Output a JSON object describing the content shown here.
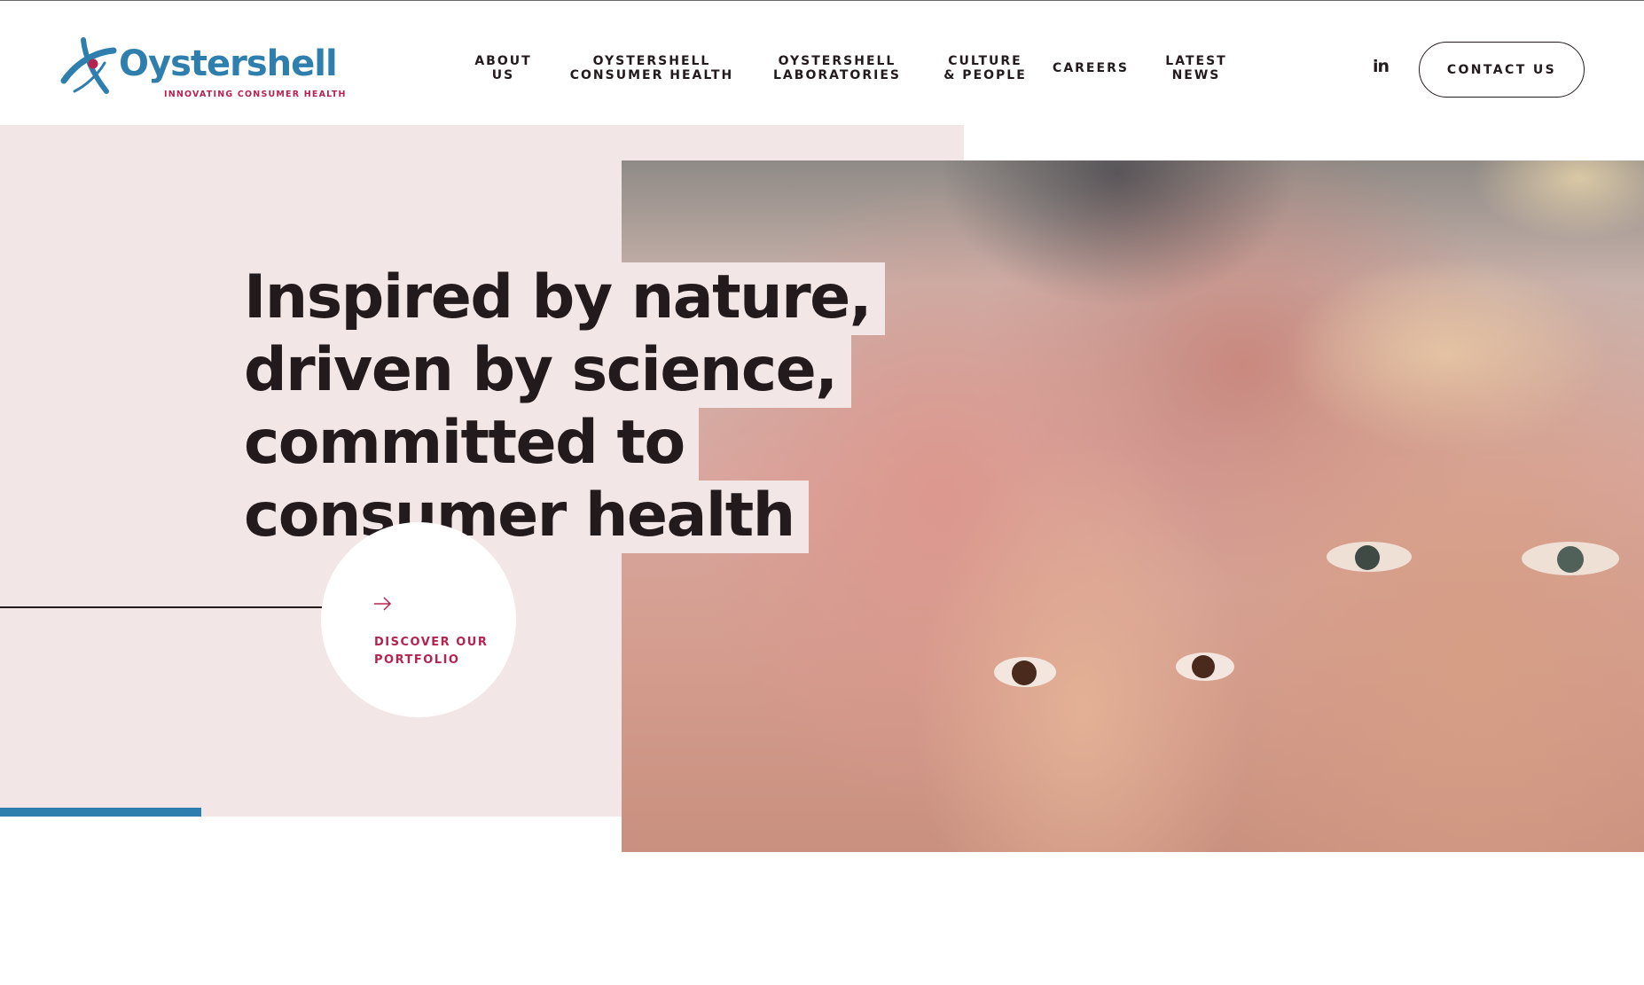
{
  "header": {
    "logo": {
      "wordmark": "Oystershell",
      "tagline": "INNOVATING CONSUMER HEALTH",
      "brand_color": "#2e7fae",
      "accent_color": "#b5234f"
    },
    "nav": [
      {
        "label": "ABOUT US"
      },
      {
        "label": "OYSTERSHELL\nCONSUMER HEALTH"
      },
      {
        "label": "OYSTERSHELL\nLABORATORIES"
      },
      {
        "label": "CULTURE\n& PEOPLE"
      },
      {
        "label": "CAREERS"
      },
      {
        "label": "LATEST\nNEWS"
      }
    ],
    "social": {
      "icon": "linkedin-icon",
      "label": "in"
    },
    "contact_label": "CONTACT US"
  },
  "hero": {
    "headline_lines": [
      "Inspired by nature,",
      "driven by science,",
      "committed to",
      "consumer health"
    ],
    "cta": {
      "icon": "arrow-right-icon",
      "label": "DISCOVER OUR\nPORTFOLIO"
    },
    "background_color": "#f2e6e6",
    "slide_progress": 0.2,
    "image": "child-and-grandmother-heart-hands-photo"
  }
}
